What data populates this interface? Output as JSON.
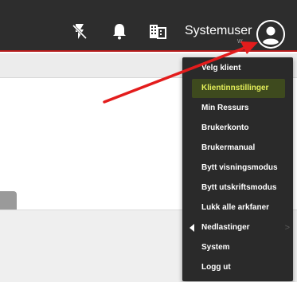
{
  "header": {
    "user_name": "Systemuser",
    "user_sub": "w..",
    "icons": [
      "flash-off-icon",
      "bell-icon",
      "building-icon",
      "account-circle-icon"
    ],
    "accent_color": "#b71c1c"
  },
  "menu": {
    "items": [
      {
        "label": "Velg klient"
      },
      {
        "label": "Klientinnstillinger",
        "highlighted": true
      },
      {
        "label": "Min Ressurs"
      },
      {
        "label": "Brukerkonto"
      },
      {
        "label": "Brukermanual"
      },
      {
        "label": "Bytt visningsmodus"
      },
      {
        "label": "Bytt utskriftsmodus"
      },
      {
        "label": "Lukk alle arkfaner"
      },
      {
        "label": "Nedlastinger",
        "submenu_left": true,
        "chevron": ">"
      },
      {
        "label": "System"
      },
      {
        "label": "Logg ut"
      }
    ],
    "highlight_color": "#e4ef5a"
  },
  "annotation": {
    "arrow_color": "#e31c1c"
  }
}
